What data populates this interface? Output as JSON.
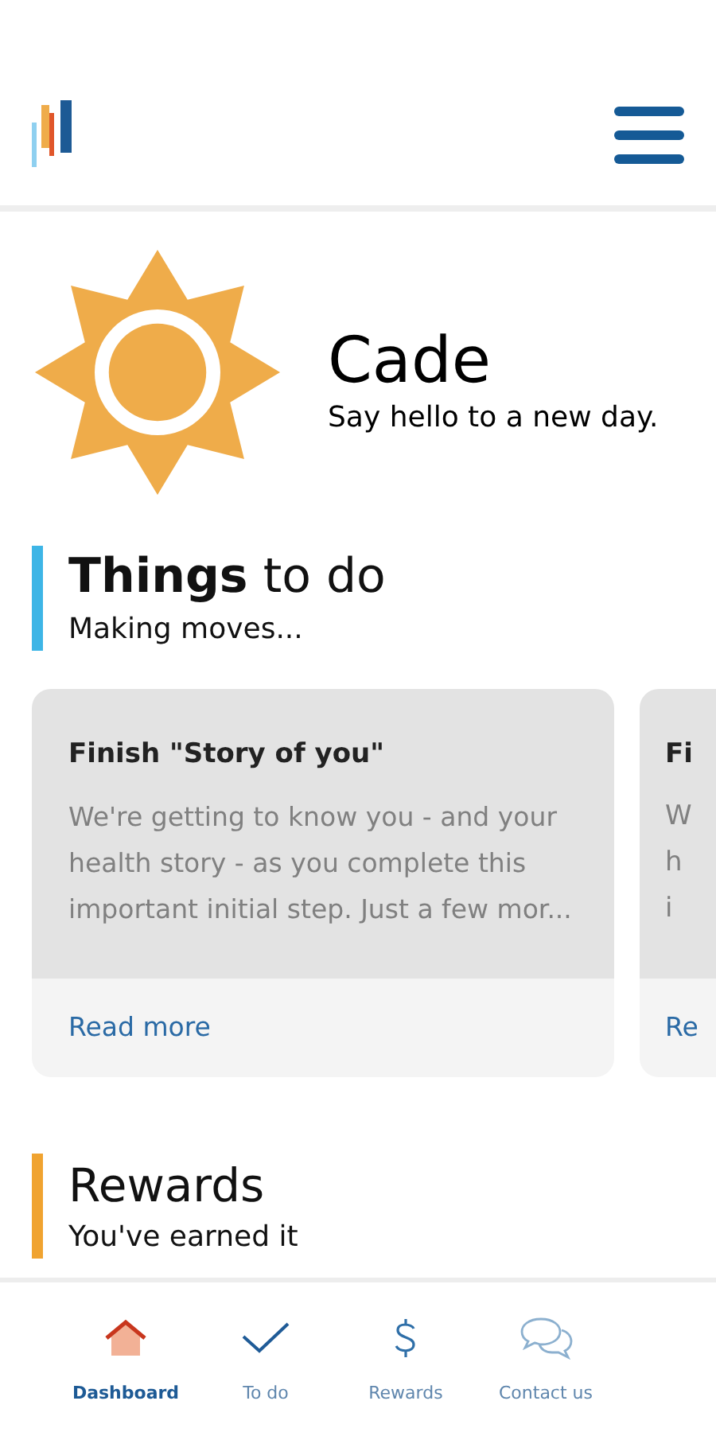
{
  "greeting": {
    "name": "Cade",
    "message": "Say hello to a new day."
  },
  "todo_section": {
    "title": "**Things** to do",
    "subtitle": "Making moves...",
    "cards": [
      {
        "kind": "full",
        "title": "Finish \"Story of you\"",
        "body": [
          "We're getting to know you - and your health story - as you complete this important initial step. Just a few mor..."
        ],
        "link": "Read more"
      },
      {
        "kind": "cut",
        "title": "Fi",
        "body": [
          "W",
          "h",
          "i"
        ],
        "link": "Re"
      }
    ]
  },
  "rewards_section": {
    "title": "Rewards",
    "subtitle": "You've earned it"
  },
  "bottom_nav": [
    {
      "kind": "home",
      "label": "Dashboard",
      "selected": true
    },
    {
      "kind": "check",
      "label": "To do",
      "selected": false
    },
    {
      "kind": "dollar",
      "label": "Rewards",
      "selected": false
    },
    {
      "kind": "chat",
      "label": "Contact us",
      "selected": false
    }
  ]
}
